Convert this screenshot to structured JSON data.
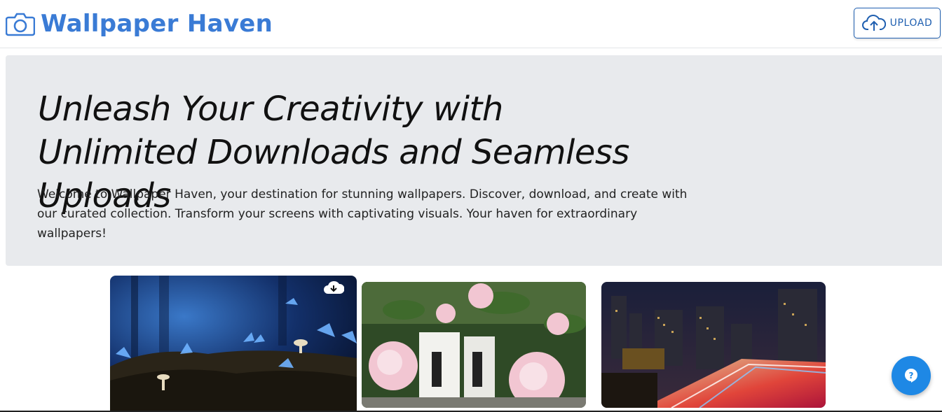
{
  "header": {
    "brand": "Wallpaper Haven",
    "brand_icon": "camera-icon",
    "upload_label": "UPLOAD",
    "upload_icon": "cloud-upload-icon"
  },
  "hero": {
    "title": "Unleash Your Creativity with Unlimited Downloads and Seamless Uploads",
    "description": "Welcome to Wallpaper Haven, your destination for stunning wallpapers. Discover, download, and create with our curated collection. Transform your screens with captivating visuals. Your haven for extraordinary wallpapers!"
  },
  "gallery": {
    "items": [
      {
        "subject": "blue butterflies and mushrooms at night",
        "hovered": true,
        "download_icon": "cloud-download-icon"
      },
      {
        "subject": "pink peonies with boxed water cartons",
        "hovered": false
      },
      {
        "subject": "city skyline at night with light trails",
        "hovered": false
      }
    ]
  },
  "help": {
    "icon": "help-icon"
  },
  "colors": {
    "brand": "#3a7bd5",
    "upload_border": "#1f5fb0",
    "hero_bg": "#e8eaed",
    "fab": "#1e88e5"
  }
}
